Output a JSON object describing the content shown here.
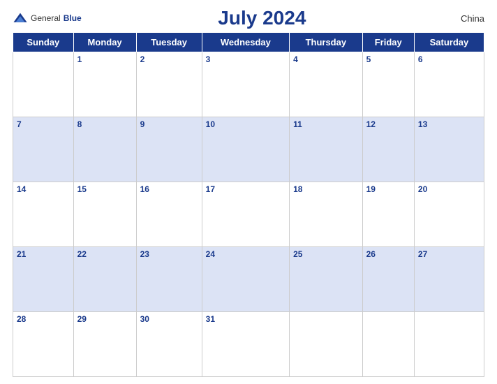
{
  "header": {
    "logo_general": "General",
    "logo_blue": "Blue",
    "title": "July 2024",
    "country": "China"
  },
  "weekdays": [
    "Sunday",
    "Monday",
    "Tuesday",
    "Wednesday",
    "Thursday",
    "Friday",
    "Saturday"
  ],
  "weeks": [
    [
      null,
      1,
      2,
      3,
      4,
      5,
      6
    ],
    [
      7,
      8,
      9,
      10,
      11,
      12,
      13
    ],
    [
      14,
      15,
      16,
      17,
      18,
      19,
      20
    ],
    [
      21,
      22,
      23,
      24,
      25,
      26,
      27
    ],
    [
      28,
      29,
      30,
      31,
      null,
      null,
      null
    ]
  ]
}
